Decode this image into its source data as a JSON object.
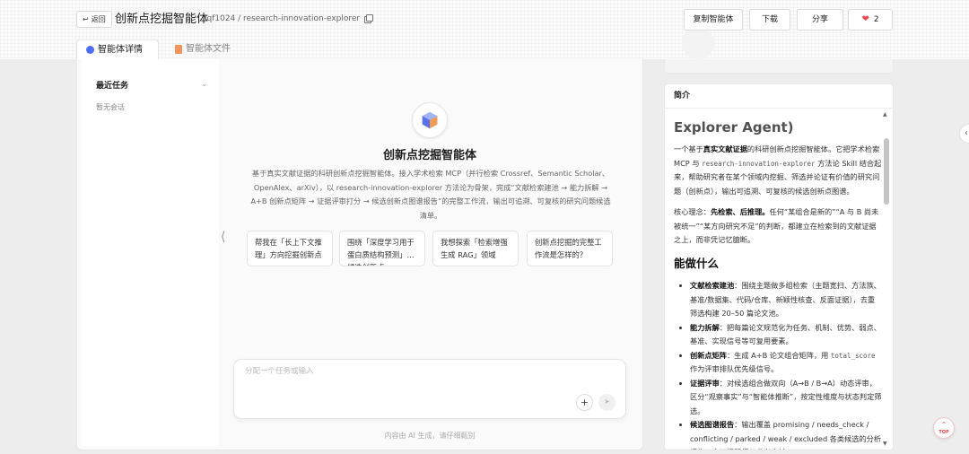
{
  "header": {
    "back_label": "返回",
    "title": "创新点挖掘智能体",
    "slug": "lqf1024 / research-innovation-explorer",
    "buttons": {
      "copy_agent": "复制智能体",
      "download": "下载",
      "share": "分享",
      "likes": "2"
    },
    "tabs": [
      {
        "label": "智能体详情",
        "active": true
      },
      {
        "label": "智能体文件",
        "active": false
      }
    ]
  },
  "sidebar": {
    "title": "最近任务",
    "empty": "暂无会话"
  },
  "agent": {
    "name": "创新点挖掘智能体",
    "description": "基于真实文献证据的科研创新点挖掘智能体。接入学术检索 MCP（并行检索 Crossref、Semantic Scholar、OpenAlex、arXiv），以 research-innovation-explorer 方法论为骨架，完成“文献检索建池 → 能力拆解 → A+B 创新点矩阵 → 证据评审打分 → 候选创新点图谱报告”的完整工作流，输出可追溯、可复核的研究问题候选清单。",
    "suggestions": [
      "帮我在「长上下文推理」方向挖掘创新点",
      "围绕「深度学习用于蛋白质结构预测」找候选创新点",
      "我想探索「检索增强生成 RAG」领域",
      "创新点挖掘的完整工作流是怎样的？"
    ]
  },
  "composer": {
    "placeholder": "分配一个任务或输入",
    "disclaimer": "内容由 AI 生成，请仔细甄别"
  },
  "intro": {
    "header": "简介",
    "cut_heading": "Explorer Agent)",
    "p1": {
      "before": "一个基于",
      "bold": "真实文献证据",
      "mid1": "的科研创新点挖掘智能体。它把学术检索 MCP 与 ",
      "code": "research-innovation-explorer",
      "after": " 方法论 Skill 结合起来，帮助研究者在某个领域内挖掘、筛选并论证有价值的研究问题（创新点），输出可追溯、可复核的候选创新点图谱。"
    },
    "p2": {
      "before": "核心理念：",
      "bold": "先检索、后推理。",
      "after": "任何“某组合是新的”“A 与 B 尚未被统一”“某方向研究不足”的判断，都建立在检索到的文献证据之上，而非凭记忆臆断。"
    },
    "section_title": "能做什么",
    "capabilities": [
      {
        "bold": "文献检索建池",
        "text": "：围绕主题做多组检索（主题宽扫、方法族、基准/数据集、代码/仓库、新颖性核查、反面证据），去重筛选构建 20–50 篇论文池。"
      },
      {
        "bold": "能力拆解",
        "text": "：把每篇论文规范化为任务、机制、优势、弱点、基准、实现信号等可复用要素。"
      },
      {
        "bold": "创新点矩阵",
        "text": "：生成 A+B 论文组合矩阵，用 ",
        "code": "total_score",
        "after": " 作为评审排队优先级信号。"
      },
      {
        "bold": "证据评审",
        "text": "：对候选组合做双向（A→B / B→A）动态评审，区分“观察事实”与“智能体推断”，按定性维度与状态判定筛选。"
      },
      {
        "bold": "候选图谱报告",
        "text": "：输出覆盖 promising / needs_check / conflicting / parked / weak / excluded 各类候选的分析报告，含证据明细与参考文献。"
      }
    ]
  },
  "backtop": "TOP"
}
